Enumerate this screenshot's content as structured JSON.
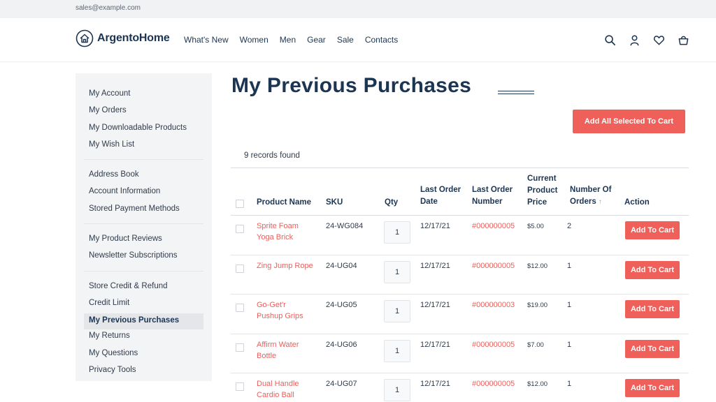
{
  "topbar": {
    "email": "sales@example.com"
  },
  "brand": {
    "name": "ArgentoHome",
    "logo_icon": "house-circle-icon"
  },
  "nav": [
    "What's New",
    "Women",
    "Men",
    "Gear",
    "Sale",
    "Contacts"
  ],
  "header_icons": [
    "search-icon",
    "account-icon",
    "wishlist-heart-icon",
    "cart-bag-icon"
  ],
  "sidebar": {
    "groups": [
      [
        "My Account",
        "My Orders",
        "My Downloadable Products",
        "My Wish List"
      ],
      [
        "Address Book",
        "Account Information",
        "Stored Payment Methods"
      ],
      [
        "My Product Reviews",
        "Newsletter Subscriptions"
      ],
      [
        "Store Credit & Refund",
        "Credit Limit",
        "My Previous Purchases",
        "My Returns",
        "My Questions",
        "Privacy Tools"
      ]
    ],
    "active": "My Previous Purchases"
  },
  "page": {
    "title": "My Previous Purchases",
    "add_all_label": "Add All Selected To Cart",
    "records": "9 records found"
  },
  "table": {
    "headers": {
      "product": "Product Name",
      "sku": "SKU",
      "qty": "Qty",
      "last_date_1": "Last Order",
      "last_date_2": "Date",
      "last_num_1": "Last Order",
      "last_num_2": "Number",
      "price_1": "Current",
      "price_2": "Product",
      "price_3": "Price",
      "orders_1": "Number Of",
      "orders_2": "Orders",
      "sort_arrow": "↑",
      "action": "Action"
    },
    "rows": [
      {
        "name1": "Sprite Foam",
        "name2": "Yoga Brick",
        "sku": "24-WG084",
        "qty": "1",
        "date": "12/17/21",
        "order": "#000000005",
        "price": "$5.00",
        "count": "2",
        "action": "Add To Cart"
      },
      {
        "name1": "Zing Jump Rope",
        "name2": "",
        "sku": "24-UG04",
        "qty": "1",
        "date": "12/17/21",
        "order": "#000000005",
        "price": "$12.00",
        "count": "1",
        "action": "Add To Cart"
      },
      {
        "name1": "Go-Get'r",
        "name2": "Pushup Grips",
        "sku": "24-UG05",
        "qty": "1",
        "date": "12/17/21",
        "order": "#000000003",
        "price": "$19.00",
        "count": "1",
        "action": "Add To Cart"
      },
      {
        "name1": "Affirm Water",
        "name2": "Bottle",
        "sku": "24-UG06",
        "qty": "1",
        "date": "12/17/21",
        "order": "#000000005",
        "price": "$7.00",
        "count": "1",
        "action": "Add To Cart"
      },
      {
        "name1": "Dual Handle",
        "name2": "Cardio Ball",
        "sku": "24-UG07",
        "qty": "1",
        "date": "12/17/21",
        "order": "#000000005",
        "price": "$12.00",
        "count": "1",
        "action": "Add To Cart"
      }
    ]
  }
}
